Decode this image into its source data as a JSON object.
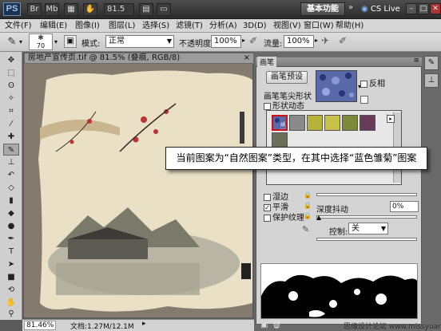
{
  "titlebar": {
    "logo": "PS",
    "zoom": "81.5",
    "workspace": "基本功能",
    "cslive": "CS Live"
  },
  "menu": [
    "文件(F)",
    "编辑(E)",
    "图像(I)",
    "图层(L)",
    "选择(S)",
    "滤镜(T)",
    "分析(A)",
    "3D(D)",
    "视图(V)",
    "窗口(W)",
    "帮助(H)"
  ],
  "options": {
    "brush_size": "70",
    "mode_label": "模式:",
    "mode_value": "正常",
    "opacity_label": "不透明度:",
    "opacity_value": "100%",
    "flow_label": "流量:",
    "flow_value": "100%"
  },
  "document": {
    "tab_title": "房地产宣传页.tif @ 81.5% (叠痕, RGB/8)",
    "zoom_status": "81.46%",
    "doc_size": "文档:1.27M/12.1M"
  },
  "brush_panel": {
    "title": "画笔",
    "preset_button": "画笔预设",
    "invert_label": "反相",
    "tip_shape_label": "画笔笔尖形状",
    "shape_dynamics_label": "形状动态",
    "opt_wet_edges": "湿边",
    "opt_smoothing": "平滑",
    "opt_protect_texture": "保护纹理",
    "depth_jitter_label": "深度抖动",
    "depth_jitter_value": "0%",
    "control_label": "控制:",
    "control_value": "关"
  },
  "callout": {
    "text": "当前图案为“自然图案”类型，在其中选择“蓝色雏菊”图案"
  },
  "watermark": {
    "text": "思缘设计论坛 www.missyuan.com"
  },
  "colors": {
    "accent_blue": "#1b3350",
    "selected_swatch_border": "#d01010",
    "swatch_blue_daisy": "#5a6aa8",
    "swatch_gray": "#8a8a8a",
    "swatch_yellow": "#b7b23a",
    "swatch_olive": "#7d8a3a",
    "swatch_purple": "#6a3a5a"
  }
}
